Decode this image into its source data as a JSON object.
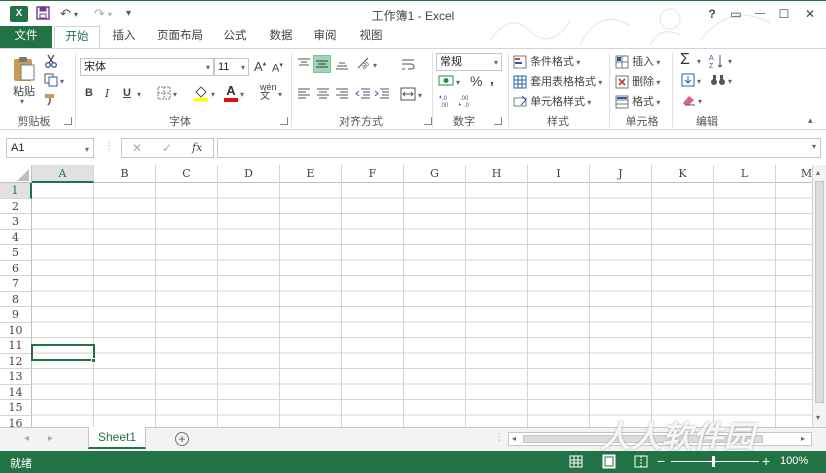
{
  "window": {
    "title": "工作簿1 - Excel",
    "app_icon": "X",
    "help": "?",
    "restore_ribbon": "▭",
    "minimize": "—",
    "maximize": "☐",
    "close": "✕"
  },
  "quick_access": {
    "save_icon": "save-icon",
    "undo": "↶",
    "redo": "↷",
    "customize": "▾"
  },
  "tabs": [
    "文件",
    "开始",
    "插入",
    "页面布局",
    "公式",
    "数据",
    "审阅",
    "视图"
  ],
  "ribbon": {
    "clipboard": {
      "paste": "粘贴",
      "label": "剪贴板"
    },
    "font": {
      "name": "宋体",
      "size": "11",
      "grow": "A",
      "shrink": "A",
      "bold": "B",
      "italic": "I",
      "underline": "U",
      "font_color_letter": "A",
      "fill_color": "◆",
      "phonetic": "wén",
      "label": "字体"
    },
    "alignment": {
      "label": "对齐方式"
    },
    "number": {
      "format": "常规",
      "percent": "%",
      "comma": ",",
      "inc_decimal": "←.0 .00",
      "dec_decimal": ".00 →.0",
      "label": "数字"
    },
    "styles": {
      "conditional": "条件格式",
      "table": "套用表格格式",
      "cell_styles": "单元格样式",
      "label": "样式"
    },
    "cells": {
      "insert": "插入",
      "delete": "删除",
      "format": "格式",
      "label": "单元格"
    },
    "editing": {
      "sum": "Σ",
      "sort": "A↓Z",
      "fill": "↓",
      "find": "🔍",
      "clear": "◆",
      "label": "编辑"
    }
  },
  "formula_bar": {
    "name_box": "A1",
    "cancel": "✕",
    "enter": "✓",
    "fx": "fx",
    "value": ""
  },
  "columns": [
    "A",
    "B",
    "C",
    "D",
    "E",
    "F",
    "G",
    "H",
    "I",
    "J",
    "K",
    "L",
    "M"
  ],
  "rows": [
    "1",
    "2",
    "3",
    "4",
    "5",
    "6",
    "7",
    "8",
    "9",
    "10",
    "11",
    "12",
    "13",
    "14",
    "15",
    "16"
  ],
  "sheets": {
    "active": "Sheet1",
    "add": "+",
    "prev": "◂",
    "next": "▸"
  },
  "status": {
    "ready": "就绪",
    "zoom": "100%",
    "zoom_out": "−",
    "zoom_in": "+"
  },
  "watermark": "人人软件园",
  "colors": {
    "accent": "#217346",
    "selected_cell_border": "#217346"
  }
}
